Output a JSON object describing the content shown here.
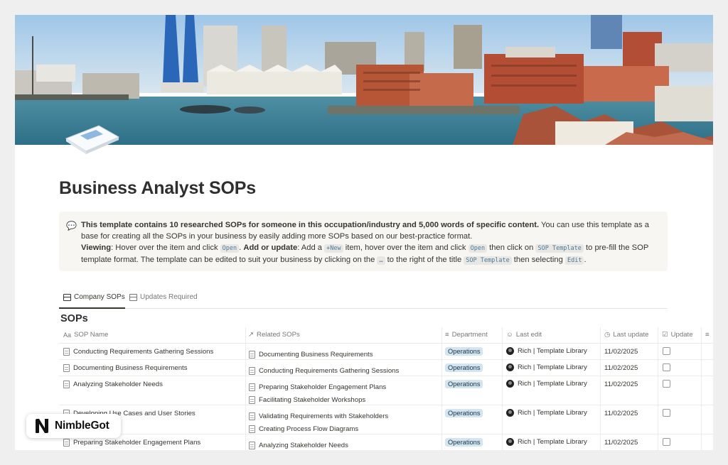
{
  "page": {
    "title": "Business Analyst SOPs"
  },
  "callout": {
    "icon": "speech-bubble-icon",
    "bold_intro": "This template contains 10 researched SOPs for someone in this occupation/industry and 5,000 words of specific content.",
    "intro_rest": " You can use this template as a base for creating all the SOPs in your business by easily adding more SOPs based on our best-practice format.",
    "viewing_label": "Viewing",
    "viewing_text_1": ": Hover over the item and click ",
    "open_code": "Open",
    "add_label": "Add or update",
    "add_text_1": ": Add a ",
    "new_code": "+New",
    "add_text_2": " item, hover over the item and click ",
    "add_text_3": " then click on ",
    "sop_template_code": "SOP Template",
    "add_text_4": " to pre-fill the SOP template format. The template can be edited to suit your business by clicking on the ",
    "dots_code": "…",
    "add_text_5": " to the right of the title ",
    "add_text_6": " then selecting ",
    "edit_code": "Edit",
    "add_text_7": "."
  },
  "tabs": [
    {
      "label": "Company SOPs",
      "active": true
    },
    {
      "label": "Updates Required",
      "active": false
    }
  ],
  "database": {
    "title": "SOPs",
    "columns": {
      "name": "SOP Name",
      "related": "Related SOPs",
      "department": "Department",
      "last_edit": "Last edit",
      "last_update": "Last update",
      "update": "Update"
    },
    "rows": [
      {
        "name": "Conducting Requirements Gathering Sessions",
        "related": [
          "Documenting Business Requirements"
        ],
        "department": "Operations",
        "editor": "Rich | Template Library",
        "date": "11/02/2025"
      },
      {
        "name": "Documenting Business Requirements",
        "related": [
          "Conducting Requirements Gathering Sessions"
        ],
        "department": "Operations",
        "editor": "Rich | Template Library",
        "date": "11/02/2025"
      },
      {
        "name": "Analyzing Stakeholder Needs",
        "related": [
          "Preparing Stakeholder Engagement Plans",
          "Facilitating Stakeholder Workshops"
        ],
        "department": "Operations",
        "editor": "Rich | Template Library",
        "date": "11/02/2025"
      },
      {
        "name": "Developing Use Cases and User Stories",
        "related": [
          "Validating Requirements with Stakeholders",
          "Creating Process Flow Diagrams"
        ],
        "department": "Operations",
        "editor": "Rich | Template Library",
        "date": "11/02/2025"
      },
      {
        "name": "Preparing Stakeholder Engagement Plans",
        "related": [
          "Analyzing Stakeholder Needs"
        ],
        "department": "Operations",
        "editor": "Rich | Template Library",
        "date": "11/02/2025"
      }
    ]
  },
  "badge": {
    "brand": "NimbleGot"
  },
  "colors": {
    "tag_bg": "#d3e5ef",
    "callout_bg": "#f7f6f3",
    "page_bg": "#efefef"
  }
}
